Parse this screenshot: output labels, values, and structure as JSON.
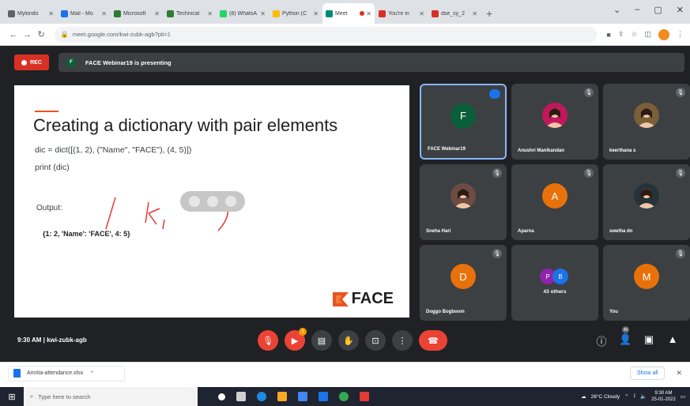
{
  "browser": {
    "tabs": [
      {
        "label": "Mylondo",
        "icon": "mylondo-icon",
        "color": "#5f6368"
      },
      {
        "label": "Mail - Mo",
        "icon": "mail-icon",
        "color": "#1a73e8"
      },
      {
        "label": "Microsoft",
        "icon": "teams-icon",
        "color": "#2e7d32"
      },
      {
        "label": "Technical",
        "icon": "teams-icon",
        "color": "#2e7d32"
      },
      {
        "label": "(8) WhatsA",
        "icon": "whatsapp-icon",
        "color": "#25d366"
      },
      {
        "label": "Python (C",
        "icon": "drive-icon",
        "color": "#fbbc04"
      },
      {
        "label": "Meet",
        "icon": "meet-icon",
        "color": "#00897b"
      },
      {
        "label": "You're in",
        "icon": "gmail-icon",
        "color": "#d93025"
      },
      {
        "label": "dse_sy_2",
        "icon": "sheet-icon",
        "color": "#d93025"
      }
    ],
    "active_tab_index": 6,
    "new_tab": "+",
    "window_controls": [
      "⌄",
      "–",
      "▢",
      "✕"
    ],
    "url": "meet.google.com/kwi-zubk-agb?pli=1"
  },
  "meet": {
    "rec_label": "REC",
    "presenter_initial": "F",
    "presenting_text": "FACE Webinar19 is presenting",
    "slide": {
      "title": "Creating a dictionary with pair elements",
      "code_line1": "dic = dict([(1, 2), (\"Name\", \"FACE\"), (4, 5)])",
      "code_line2": "print (dic)",
      "output_label": "Output:",
      "output_value": "{1: 2, 'Name': 'FACE', 4: 5}",
      "logo_text": "FACE"
    },
    "participants": [
      {
        "name": "FACE Webinar19",
        "initial": "F",
        "color": "#0b5e3a",
        "type": "avatar",
        "active": true
      },
      {
        "name": "Anushri Manikandan",
        "initial": "",
        "color": "#c2185b",
        "type": "photo",
        "active": false
      },
      {
        "name": "keerthana s",
        "initial": "",
        "color": "#7b5e3a",
        "type": "photo",
        "active": false
      },
      {
        "name": "Sneha Hari",
        "initial": "",
        "color": "#6d4c41",
        "type": "photo",
        "active": false
      },
      {
        "name": "Aparna",
        "initial": "A",
        "color": "#e8710a",
        "type": "avatar",
        "active": false
      },
      {
        "name": "swetha dn",
        "initial": "",
        "color": "#263238",
        "type": "photo",
        "active": false
      },
      {
        "name": "Doggo Bogboom",
        "initial": "D",
        "color": "#e8710a",
        "type": "avatar",
        "active": false
      },
      {
        "name": "43 others",
        "initial": "",
        "color": "#5f6368",
        "type": "others",
        "active": false
      },
      {
        "name": "You",
        "initial": "M",
        "color": "#e8710a",
        "type": "avatar",
        "active": false
      }
    ],
    "others_initials": [
      "P",
      "B"
    ],
    "others_colors": [
      "#8e24aa",
      "#1a73e8"
    ],
    "meeting_info": "9:30 AM  |  kwi-zubk-agb",
    "controls": [
      "mic-off",
      "camera-off",
      "captions",
      "raise-hand",
      "present",
      "more"
    ],
    "control_badge": "1",
    "people_count": "46"
  },
  "downloads": {
    "file_name": "Amrita-attendance.xlsx",
    "show_all": "Show all"
  },
  "taskbar": {
    "search_placeholder": "Type here to search",
    "weather": "26°C  Cloudy",
    "time": "9:30 AM",
    "date": "25-01-2022"
  }
}
